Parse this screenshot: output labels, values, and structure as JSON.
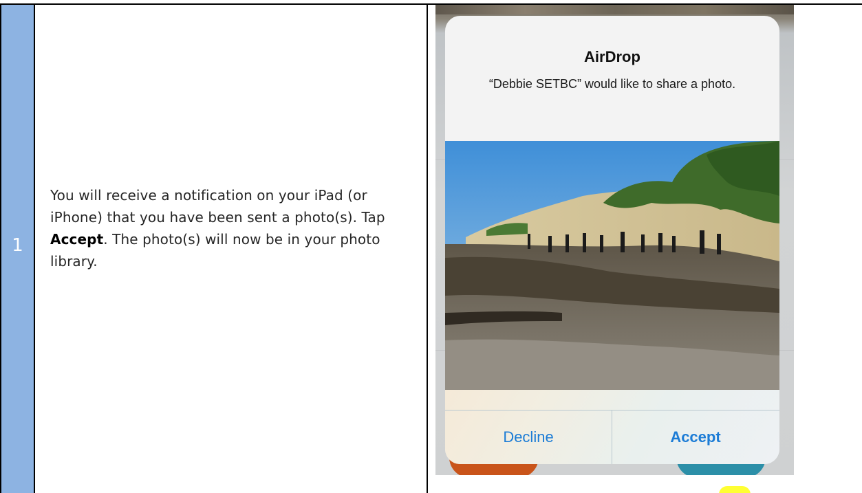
{
  "step": {
    "number": "1"
  },
  "instruction": {
    "part1": "You will receive a notification on your iPad (or iPhone) that you have been sent a photo(s).  Tap ",
    "accept_word": "Accept",
    "part2": ".  The photo(s) will now be in your photo library."
  },
  "dialog": {
    "title": "AirDrop",
    "message": "“Debbie SETBC” would like to share a photo.",
    "decline_label": "Decline",
    "accept_label": "Accept"
  },
  "colors": {
    "step_cell": "#8db3e2",
    "button_text": "#1c7cd6",
    "highlight": "#ffff33"
  }
}
